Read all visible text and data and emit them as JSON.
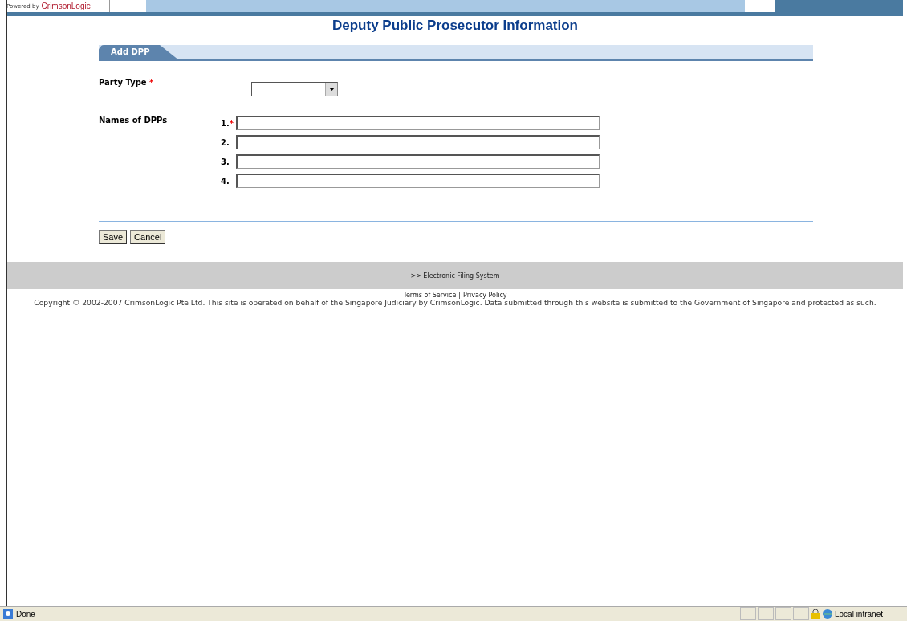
{
  "header": {
    "powered_by": "Powered by",
    "logo": "CrimsonLogic"
  },
  "page_title": "Deputy Public Prosecutor Information",
  "tab": {
    "label": "Add DPP",
    "selected": true
  },
  "form": {
    "party_type": {
      "label": "Party Type",
      "required_mark": "*"
    },
    "names": {
      "label": "Names of DPPs",
      "rows": [
        {
          "number": "1.",
          "required_mark": "*"
        },
        {
          "number": "2."
        },
        {
          "number": "3."
        },
        {
          "number": "4."
        }
      ]
    }
  },
  "buttons": [
    "Save",
    "Cancel"
  ],
  "footer": {
    "nav_link": ">> Electronic Filing System",
    "links": [
      "Terms of Service",
      "Privacy Policy"
    ],
    "separator": "|",
    "copyright": "Copyright © 2002-2007 CrimsonLogic Pte Ltd. This site is operated on behalf of the Singapore Judiciary by CrimsonLogic. Data submitted through this website is submitted to the Government of Singapore and protected as such."
  },
  "status_bar": {
    "status": "Done",
    "zone": "Local intranet"
  }
}
